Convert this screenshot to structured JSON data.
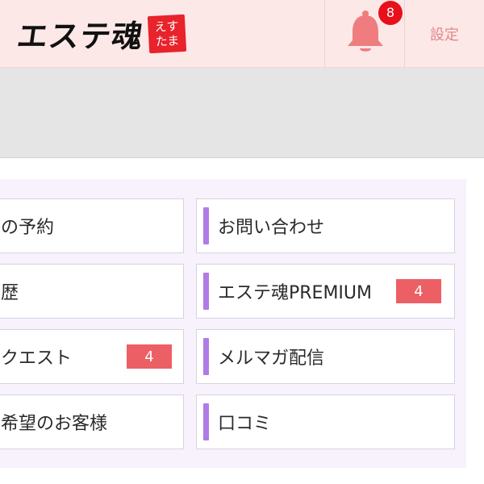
{
  "header": {
    "logo_text": "エステ魂",
    "logo_stamp_line1": "えす",
    "logo_stamp_line2": "たま",
    "notification_count": "8",
    "settings_label": "設定",
    "colors": {
      "background": "#fde8e8",
      "bell": "#ef7d7f",
      "badge": "#e8101b",
      "settings": "#e2888c"
    }
  },
  "menu": {
    "left": [
      {
        "label": "の予約"
      },
      {
        "label": "歴"
      },
      {
        "label": "クエスト",
        "badge": "4"
      },
      {
        "label": "希望のお客様"
      }
    ],
    "right": [
      {
        "label": "お問い合わせ"
      },
      {
        "label": "エステ魂PREMIUM",
        "badge": "4"
      },
      {
        "label": "メルマガ配信"
      },
      {
        "label": "口コミ"
      }
    ],
    "colors": {
      "accent": "#b07be6",
      "badge": "#ec5f65",
      "area": "#f7f2fb"
    }
  }
}
